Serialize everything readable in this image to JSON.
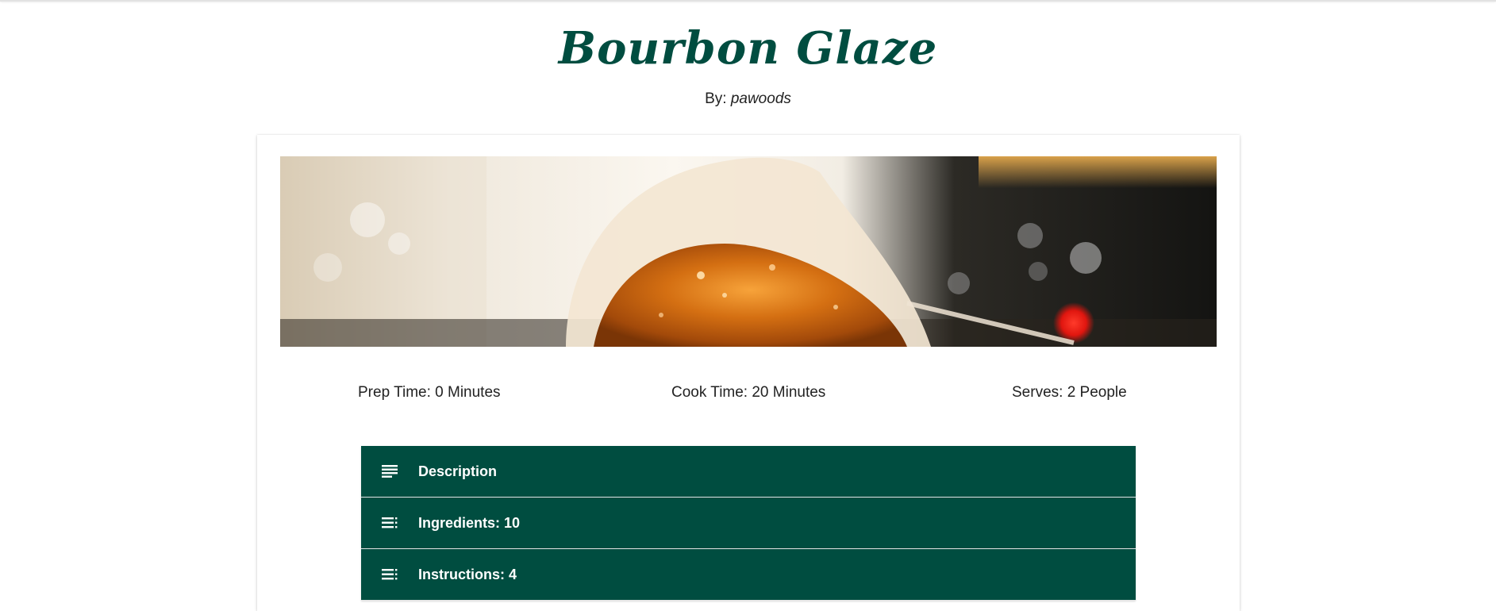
{
  "recipe": {
    "title": "Bourbon Glaze",
    "by_label": "By:",
    "author": "pawoods",
    "hero_image": "spoon of bourbon glaze over a stove"
  },
  "stats": {
    "prep": "Prep Time: 0 Minutes",
    "cook": "Cook Time: 20 Minutes",
    "serves": "Serves: 2 People"
  },
  "sections": [
    {
      "label": "Description",
      "icon": "subject-icon"
    },
    {
      "label": "Ingredients: 10",
      "icon": "playlist-icon"
    },
    {
      "label": "Instructions: 4",
      "icon": "playlist-icon"
    }
  ],
  "colors": {
    "accent": "#004d40",
    "text": "#222222",
    "background": "#ffffff"
  }
}
